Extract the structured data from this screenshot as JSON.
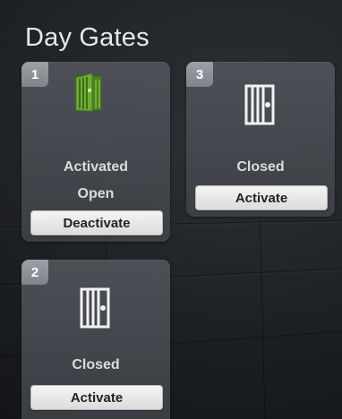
{
  "page": {
    "title": "Day Gates"
  },
  "gates": [
    {
      "number": "1",
      "status_lines": [
        "Activated",
        "Open"
      ],
      "button_label": "Deactivate",
      "icon": "gate-open-icon",
      "icon_color": "#5e9a2a"
    },
    {
      "number": "3",
      "status_lines": [
        "Closed"
      ],
      "button_label": "Activate",
      "icon": "gate-closed-icon",
      "icon_color": "#f2f2f2"
    },
    {
      "number": "2",
      "status_lines": [
        "Closed"
      ],
      "button_label": "Activate",
      "icon": "gate-closed-icon",
      "icon_color": "#f2f2f2"
    }
  ]
}
